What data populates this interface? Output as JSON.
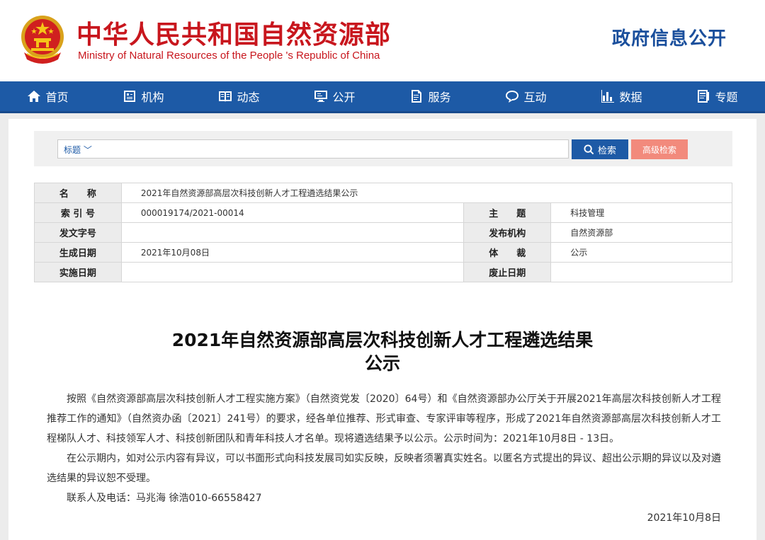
{
  "header": {
    "title": "中华人民共和国自然资源部",
    "subtitle": "Ministry of Natural Resources of the People 's Republic of China",
    "gov_info": "政府信息公开"
  },
  "nav": [
    {
      "label": "首页",
      "icon": "home-icon"
    },
    {
      "label": "机构",
      "icon": "institution-icon"
    },
    {
      "label": "动态",
      "icon": "news-icon"
    },
    {
      "label": "公开",
      "icon": "disclosure-icon"
    },
    {
      "label": "服务",
      "icon": "service-icon"
    },
    {
      "label": "互动",
      "icon": "chat-icon"
    },
    {
      "label": "数据",
      "icon": "data-chart-icon"
    },
    {
      "label": "专题",
      "icon": "topic-icon"
    }
  ],
  "search": {
    "scope": "标题",
    "placeholder": "",
    "button": "检索",
    "advanced": "高级检索"
  },
  "meta": {
    "name_label": "名　　称",
    "name_value": "2021年自然资源部高层次科技创新人才工程遴选结果公示",
    "index_label": "索 引 号",
    "index_value": "000019174/2021-00014",
    "subject_label": "主　　题",
    "subject_value": "科技管理",
    "docno_label": "发文字号",
    "docno_value": "",
    "issuer_label": "发布机构",
    "issuer_value": "自然资源部",
    "created_label": "生成日期",
    "created_value": "2021年10月08日",
    "genre_label": "体　　裁",
    "genre_value": "公示",
    "effective_label": "实施日期",
    "effective_value": "",
    "expire_label": "废止日期",
    "expire_value": ""
  },
  "article": {
    "title_line1": "2021年自然资源部高层次科技创新人才工程遴选结果",
    "title_line2": "公示",
    "para1": "按照《自然资源部高层次科技创新人才工程实施方案》（自然资党发〔2020〕64号）和《自然资源部办公厅关于开展2021年高层次科技创新人才工程推荐工作的通知》（自然资办函〔2021〕241号）的要求，经各单位推荐、形式审查、专家评审等程序，形成了2021年自然资源部高层次科技创新人才工程梯队人才、科技领军人才、科技创新团队和青年科技人才名单。现将遴选结果予以公示。公示时间为：2021年10月8日 - 13日。",
    "para2": "在公示期内，如对公示内容有异议，可以书面形式向科技发展司如实反映，反映者须署真实姓名。以匿名方式提出的异议、超出公示期的异议以及对遴选结果的异议恕不受理。",
    "para3": "联系人及电话：马兆海 徐浩010-66558427",
    "date": "2021年10月8日"
  },
  "colors": {
    "brand_red": "#c8161d",
    "nav_blue": "#1d5aa6",
    "advanced_btn": "#f28a7c"
  }
}
